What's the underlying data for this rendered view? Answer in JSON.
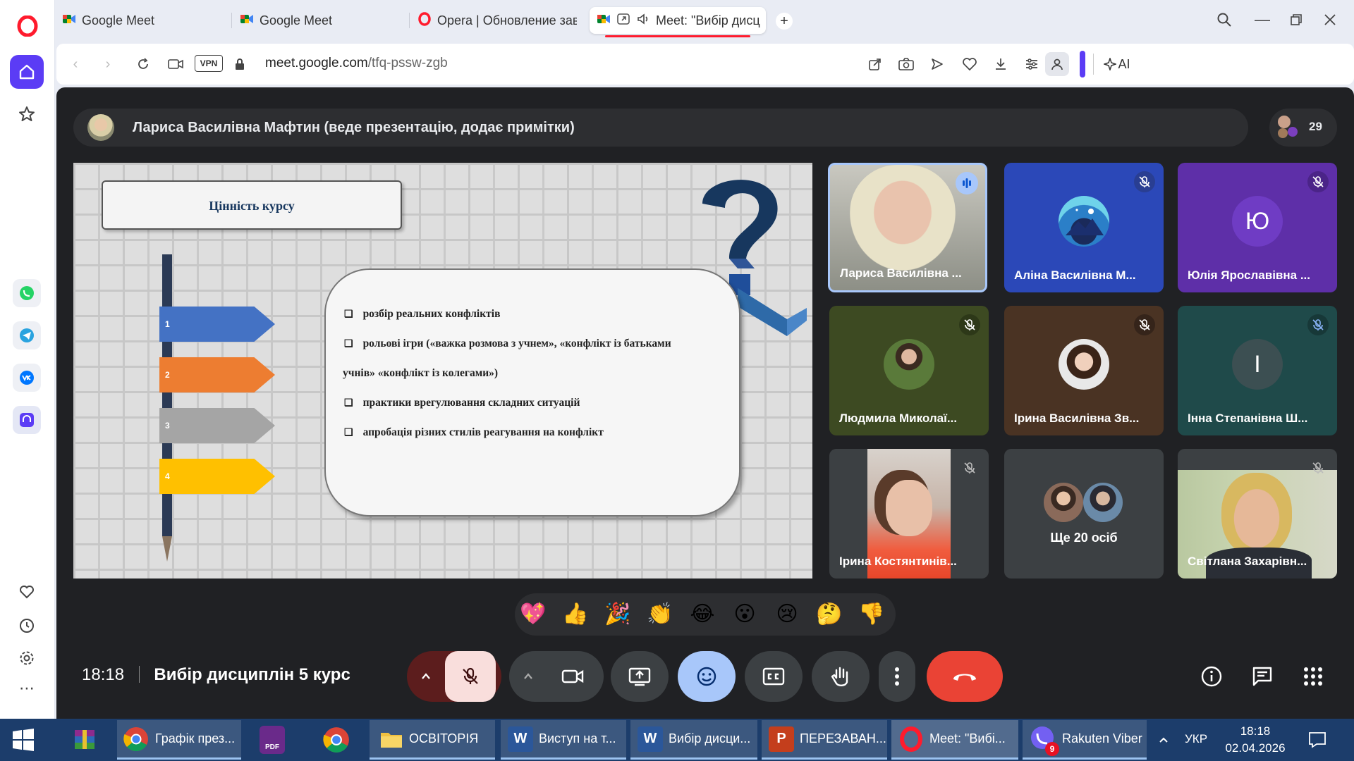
{
  "browser": {
    "tabs": [
      {
        "label": "Google Meet"
      },
      {
        "label": "Google Meet"
      },
      {
        "label": "Opera | Обновление заве"
      },
      {
        "label": "Meet: \"Вибір дисц"
      }
    ],
    "url_domain": "meet.google.com",
    "url_path": "/tfq-pssw-zgb",
    "vpn_label": "VPN",
    "ai_label": "AI"
  },
  "meet": {
    "presenter_text": "Лариса Василівна Мафтин (веде презентацію, додає примітки)",
    "participant_count": "29",
    "clock": "18:18",
    "meeting_title": "Вибір дисциплін 5 курс"
  },
  "slide": {
    "title": "Цінність курсу",
    "steps": [
      "1",
      "2",
      "3",
      "4"
    ],
    "bullets": [
      "розбір реальних конфліктів",
      "рольові ігри («важка розмова з учнем», «конфлікт із батьками",
      "учнів» «конфлікт із колегами»)",
      "практики  врегулювання складних ситуацій",
      "апробація різних стилів реагування на конфлікт"
    ]
  },
  "participants": [
    {
      "name": "Лариса Василівна ...",
      "avatar": ""
    },
    {
      "name": "Аліна Василівна М...",
      "avatar": ""
    },
    {
      "name": "Юлія Ярославівна ...",
      "avatar": "Ю"
    },
    {
      "name": "Людмила Миколаї...",
      "avatar": ""
    },
    {
      "name": "Ірина Василівна Зв...",
      "avatar": ""
    },
    {
      "name": "Інна Степанівна Ш...",
      "avatar": "І"
    },
    {
      "name": "Ірина Костянтинів...",
      "avatar": ""
    },
    {
      "name": "Ще 20 осіб",
      "avatar": ""
    },
    {
      "name": "Світлана Захарівн...",
      "avatar": ""
    }
  ],
  "reactions": [
    "💖",
    "👍",
    "🎉",
    "👏",
    "😂",
    "😮",
    "😢",
    "🤔",
    "👎"
  ],
  "taskbar": {
    "apps": [
      {
        "label": "Графік през..."
      },
      {
        "label": "ОСВІТОРІЯ"
      },
      {
        "label": "Виступ на т..."
      },
      {
        "label": "Вибір дисци..."
      },
      {
        "label": "ПЕРЕЗАВАН..."
      },
      {
        "label": "Meet: \"Вибі..."
      },
      {
        "label": "Rakuten Viber"
      }
    ],
    "viber_badge": "9",
    "pdf_label": "PDF",
    "lang": "УКР",
    "time": "18:18",
    "date": "02.04.2026"
  },
  "colors": {
    "meet_bg": "#202124",
    "accent_blue": "#a8c7fa",
    "end_call": "#ea4335",
    "mic_off_bg": "#f9dedc",
    "opera_red": "#ff1b2d",
    "taskbar": "#1c3d6b"
  }
}
